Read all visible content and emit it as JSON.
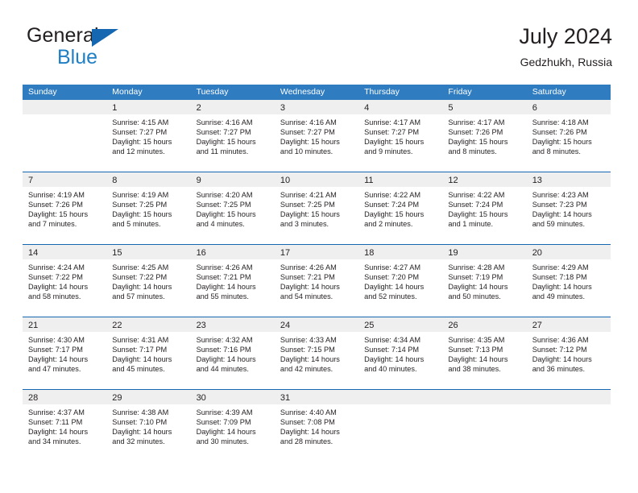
{
  "branding": {
    "logo_text_primary": "General",
    "logo_text_secondary": "Blue",
    "logo_icon": "triangle-flag-icon",
    "accent_color": "#1667b1",
    "secondary_color": "#1f7fc4"
  },
  "header": {
    "title": "July 2024",
    "subtitle": "Gedzhukh, Russia"
  },
  "colors": {
    "header_row_bg": "#2f7cc0",
    "day_band_bg": "#efefef",
    "week_divider": "#1667b1",
    "text": "#231f20"
  },
  "weekdays": [
    "Sunday",
    "Monday",
    "Tuesday",
    "Wednesday",
    "Thursday",
    "Friday",
    "Saturday"
  ],
  "weeks": [
    [
      {
        "day": "",
        "lines": []
      },
      {
        "day": "1",
        "lines": [
          "Sunrise: 4:15 AM",
          "Sunset: 7:27 PM",
          "Daylight: 15 hours",
          "and 12 minutes."
        ]
      },
      {
        "day": "2",
        "lines": [
          "Sunrise: 4:16 AM",
          "Sunset: 7:27 PM",
          "Daylight: 15 hours",
          "and 11 minutes."
        ]
      },
      {
        "day": "3",
        "lines": [
          "Sunrise: 4:16 AM",
          "Sunset: 7:27 PM",
          "Daylight: 15 hours",
          "and 10 minutes."
        ]
      },
      {
        "day": "4",
        "lines": [
          "Sunrise: 4:17 AM",
          "Sunset: 7:27 PM",
          "Daylight: 15 hours",
          "and 9 minutes."
        ]
      },
      {
        "day": "5",
        "lines": [
          "Sunrise: 4:17 AM",
          "Sunset: 7:26 PM",
          "Daylight: 15 hours",
          "and 8 minutes."
        ]
      },
      {
        "day": "6",
        "lines": [
          "Sunrise: 4:18 AM",
          "Sunset: 7:26 PM",
          "Daylight: 15 hours",
          "and 8 minutes."
        ]
      }
    ],
    [
      {
        "day": "7",
        "lines": [
          "Sunrise: 4:19 AM",
          "Sunset: 7:26 PM",
          "Daylight: 15 hours",
          "and 7 minutes."
        ]
      },
      {
        "day": "8",
        "lines": [
          "Sunrise: 4:19 AM",
          "Sunset: 7:25 PM",
          "Daylight: 15 hours",
          "and 5 minutes."
        ]
      },
      {
        "day": "9",
        "lines": [
          "Sunrise: 4:20 AM",
          "Sunset: 7:25 PM",
          "Daylight: 15 hours",
          "and 4 minutes."
        ]
      },
      {
        "day": "10",
        "lines": [
          "Sunrise: 4:21 AM",
          "Sunset: 7:25 PM",
          "Daylight: 15 hours",
          "and 3 minutes."
        ]
      },
      {
        "day": "11",
        "lines": [
          "Sunrise: 4:22 AM",
          "Sunset: 7:24 PM",
          "Daylight: 15 hours",
          "and 2 minutes."
        ]
      },
      {
        "day": "12",
        "lines": [
          "Sunrise: 4:22 AM",
          "Sunset: 7:24 PM",
          "Daylight: 15 hours",
          "and 1 minute."
        ]
      },
      {
        "day": "13",
        "lines": [
          "Sunrise: 4:23 AM",
          "Sunset: 7:23 PM",
          "Daylight: 14 hours",
          "and 59 minutes."
        ]
      }
    ],
    [
      {
        "day": "14",
        "lines": [
          "Sunrise: 4:24 AM",
          "Sunset: 7:22 PM",
          "Daylight: 14 hours",
          "and 58 minutes."
        ]
      },
      {
        "day": "15",
        "lines": [
          "Sunrise: 4:25 AM",
          "Sunset: 7:22 PM",
          "Daylight: 14 hours",
          "and 57 minutes."
        ]
      },
      {
        "day": "16",
        "lines": [
          "Sunrise: 4:26 AM",
          "Sunset: 7:21 PM",
          "Daylight: 14 hours",
          "and 55 minutes."
        ]
      },
      {
        "day": "17",
        "lines": [
          "Sunrise: 4:26 AM",
          "Sunset: 7:21 PM",
          "Daylight: 14 hours",
          "and 54 minutes."
        ]
      },
      {
        "day": "18",
        "lines": [
          "Sunrise: 4:27 AM",
          "Sunset: 7:20 PM",
          "Daylight: 14 hours",
          "and 52 minutes."
        ]
      },
      {
        "day": "19",
        "lines": [
          "Sunrise: 4:28 AM",
          "Sunset: 7:19 PM",
          "Daylight: 14 hours",
          "and 50 minutes."
        ]
      },
      {
        "day": "20",
        "lines": [
          "Sunrise: 4:29 AM",
          "Sunset: 7:18 PM",
          "Daylight: 14 hours",
          "and 49 minutes."
        ]
      }
    ],
    [
      {
        "day": "21",
        "lines": [
          "Sunrise: 4:30 AM",
          "Sunset: 7:17 PM",
          "Daylight: 14 hours",
          "and 47 minutes."
        ]
      },
      {
        "day": "22",
        "lines": [
          "Sunrise: 4:31 AM",
          "Sunset: 7:17 PM",
          "Daylight: 14 hours",
          "and 45 minutes."
        ]
      },
      {
        "day": "23",
        "lines": [
          "Sunrise: 4:32 AM",
          "Sunset: 7:16 PM",
          "Daylight: 14 hours",
          "and 44 minutes."
        ]
      },
      {
        "day": "24",
        "lines": [
          "Sunrise: 4:33 AM",
          "Sunset: 7:15 PM",
          "Daylight: 14 hours",
          "and 42 minutes."
        ]
      },
      {
        "day": "25",
        "lines": [
          "Sunrise: 4:34 AM",
          "Sunset: 7:14 PM",
          "Daylight: 14 hours",
          "and 40 minutes."
        ]
      },
      {
        "day": "26",
        "lines": [
          "Sunrise: 4:35 AM",
          "Sunset: 7:13 PM",
          "Daylight: 14 hours",
          "and 38 minutes."
        ]
      },
      {
        "day": "27",
        "lines": [
          "Sunrise: 4:36 AM",
          "Sunset: 7:12 PM",
          "Daylight: 14 hours",
          "and 36 minutes."
        ]
      }
    ],
    [
      {
        "day": "28",
        "lines": [
          "Sunrise: 4:37 AM",
          "Sunset: 7:11 PM",
          "Daylight: 14 hours",
          "and 34 minutes."
        ]
      },
      {
        "day": "29",
        "lines": [
          "Sunrise: 4:38 AM",
          "Sunset: 7:10 PM",
          "Daylight: 14 hours",
          "and 32 minutes."
        ]
      },
      {
        "day": "30",
        "lines": [
          "Sunrise: 4:39 AM",
          "Sunset: 7:09 PM",
          "Daylight: 14 hours",
          "and 30 minutes."
        ]
      },
      {
        "day": "31",
        "lines": [
          "Sunrise: 4:40 AM",
          "Sunset: 7:08 PM",
          "Daylight: 14 hours",
          "and 28 minutes."
        ]
      },
      {
        "day": "",
        "lines": []
      },
      {
        "day": "",
        "lines": []
      },
      {
        "day": "",
        "lines": []
      }
    ]
  ]
}
